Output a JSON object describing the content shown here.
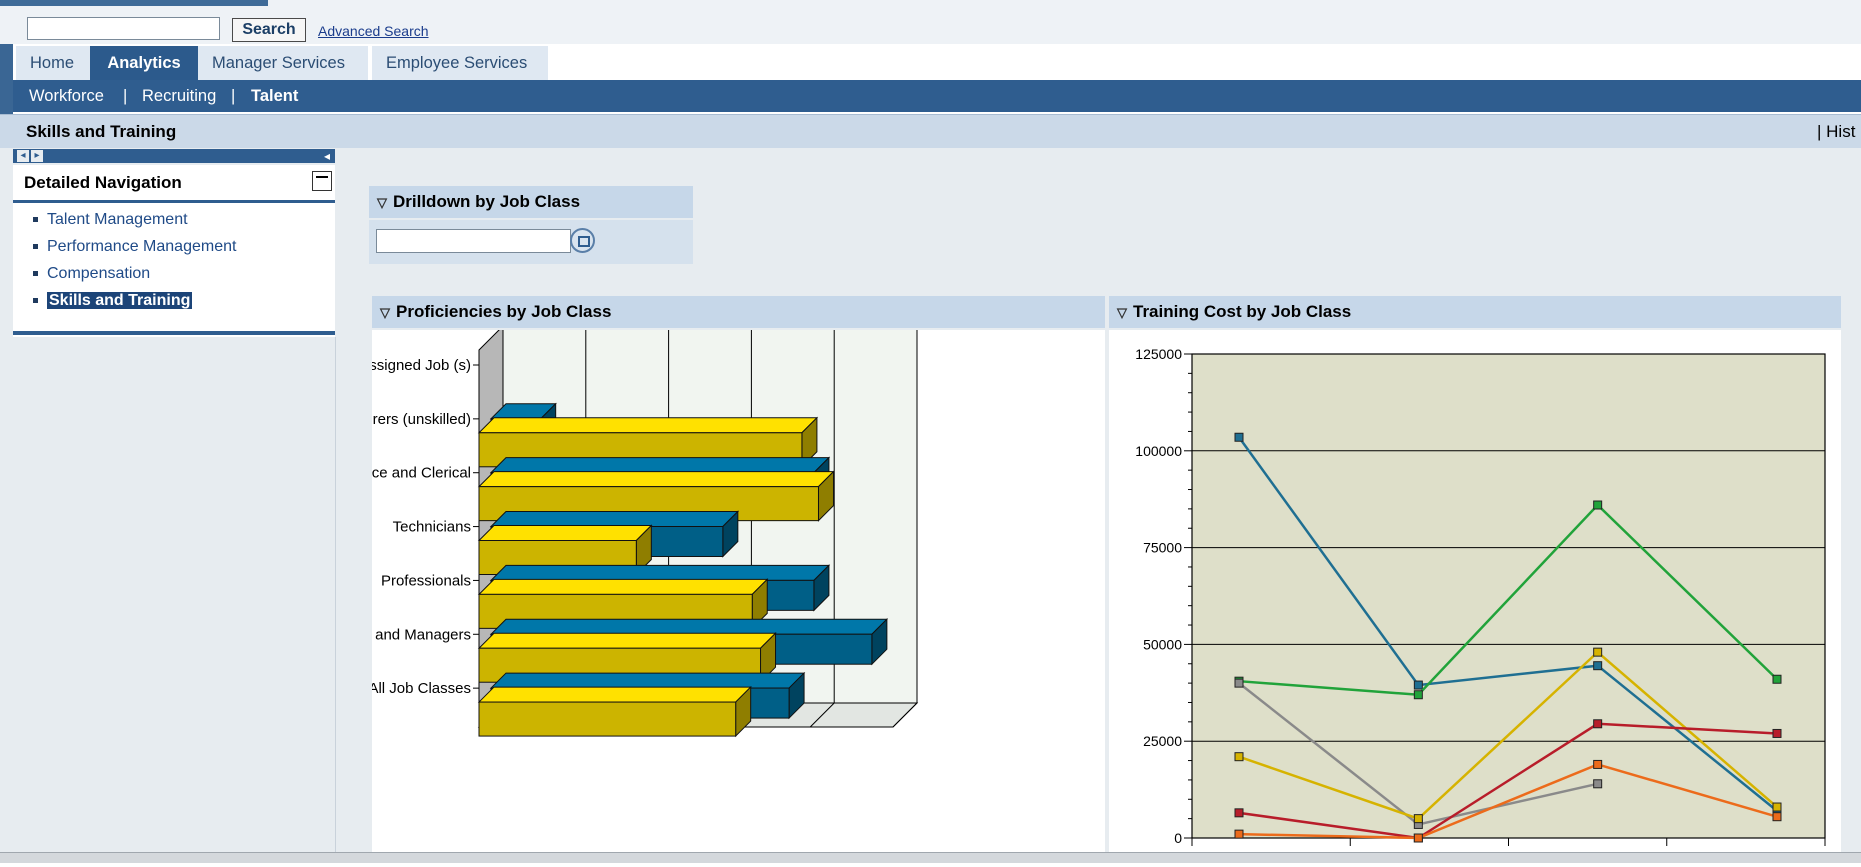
{
  "search": {
    "button_label": "Search",
    "advanced_label": "Advanced Search",
    "value": ""
  },
  "nav": {
    "tabs": [
      {
        "label": "Home",
        "active": false
      },
      {
        "label": "Analytics",
        "active": true
      },
      {
        "label": "Manager Services",
        "active": false
      },
      {
        "label": "Employee Services",
        "active": false
      }
    ],
    "subnav": [
      {
        "label": "Workforce",
        "active": false
      },
      {
        "label": "Recruiting",
        "active": false
      },
      {
        "label": "Talent",
        "active": true
      }
    ],
    "separator": "|"
  },
  "page": {
    "title": "Skills and Training",
    "history_label": "|  Hist"
  },
  "left_nav": {
    "title": "Detailed Navigation",
    "items": [
      {
        "label": "Talent Management",
        "active": false
      },
      {
        "label": "Performance Management",
        "active": false
      },
      {
        "label": "Compensation",
        "active": false
      },
      {
        "label": "Skills and Training",
        "active": true
      }
    ]
  },
  "panels": {
    "drilldown": {
      "title": "Drilldown by Job Class",
      "value": ""
    },
    "proficiencies": {
      "title": "Proficiencies by Job Class"
    },
    "training_cost": {
      "title": "Training Cost by Job Class"
    }
  },
  "colors": {
    "primary_blue": "#2f5d8f",
    "header_light": "#c6d7e9",
    "bar_yellow": "#ccb400",
    "bar_teal": "#005f87"
  },
  "chart_data": [
    {
      "type": "bar",
      "orientation": "horizontal",
      "categories": [
        "Not Assigned Job (s)",
        "Laborers (unskilled)",
        "Office and Clerical",
        "Technicians",
        "Professionals",
        "Officials and Managers",
        "All Job Classes"
      ],
      "series": [
        {
          "color": "#005f87",
          "values": [
            0,
            0.6,
            3.9,
            2.8,
            3.9,
            4.6,
            3.6
          ]
        },
        {
          "color": "#ccb400",
          "values": [
            0,
            3.9,
            4.1,
            1.9,
            3.3,
            3.4,
            3.1
          ]
        }
      ],
      "xlim": [
        0,
        5
      ],
      "grid": true
    },
    {
      "type": "line",
      "x": [
        "",
        "",
        "",
        ""
      ],
      "ylim": [
        0,
        125000
      ],
      "yticks": [
        0,
        25000,
        50000,
        75000,
        100000,
        125000
      ],
      "series": [
        {
          "color": "#1f6f92",
          "values": [
            103500,
            39500,
            44500,
            7000
          ]
        },
        {
          "color": "#21a33a",
          "values": [
            40500,
            37000,
            86000,
            41000
          ]
        },
        {
          "color": "#8a8a8a",
          "values": [
            40000,
            3500,
            14000,
            null
          ]
        },
        {
          "color": "#d6b300",
          "values": [
            21000,
            5000,
            48000,
            8000
          ]
        },
        {
          "color": "#b81d2a",
          "values": [
            6500,
            0,
            29500,
            27000
          ]
        },
        {
          "color": "#ec6b1b",
          "values": [
            1000,
            0,
            19000,
            5500
          ]
        }
      ],
      "grid": true
    }
  ]
}
